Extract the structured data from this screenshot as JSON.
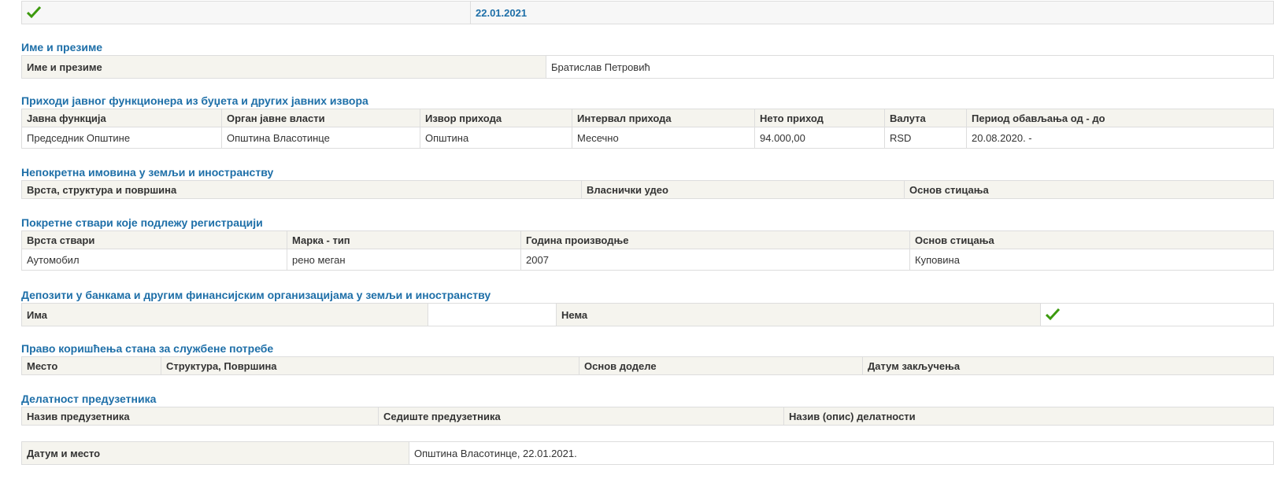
{
  "top": {
    "date": "22.01.2021"
  },
  "name_section": {
    "title": "Име и презиме",
    "label": "Име и презиме",
    "value": "Братислав Петровић"
  },
  "income": {
    "title": "Приходи јавног функционера из буџета и других јавних извора",
    "headers": [
      "Јавна функција",
      "Орган јавне власти",
      "Извор прихода",
      "Интервал прихода",
      "Нето приход",
      "Валута",
      "Период обављања од - до"
    ],
    "rows": [
      [
        "Председник Општине",
        "Општина Власотинце",
        "Општина",
        "Месечно",
        "94.000,00",
        "RSD",
        "20.08.2020. -"
      ]
    ]
  },
  "real_estate": {
    "title": "Непокретна имовина у земљи и иностранству",
    "headers": [
      "Врста, структура и површина",
      "Власнички удео",
      "Основ стицања"
    ]
  },
  "movables": {
    "title": "Покретне ствари које подлежу регистрацији",
    "headers": [
      "Врста ствари",
      "Марка - тип",
      "Година производње",
      "Основ стицања"
    ],
    "rows": [
      [
        "Аутомобил",
        "рено меган",
        "2007",
        "Куповина"
      ]
    ]
  },
  "deposits": {
    "title": "Депозити у банкама и другим финансијским организацијама у земљи и иностранству",
    "has_label": "Има",
    "none_label": "Нема"
  },
  "apartment": {
    "title": "Право коришћења стана за службене потребе",
    "headers": [
      "Место",
      "Структура, Површина",
      "Основ доделе",
      "Датум закључења"
    ]
  },
  "business": {
    "title": "Делатност предузетника",
    "headers": [
      "Назив предузетника",
      "Седиште предузетника",
      "Назив (опис) делатности"
    ]
  },
  "footer": {
    "label": "Датум и место",
    "value": "Општина Власотинце, 22.01.2021."
  },
  "icons": {
    "check_color": "#3c9a0e",
    "check": "check-icon"
  },
  "colors": {
    "section_title": "#1e6fa8",
    "header_bg": "#f5f4ee",
    "border": "#dddddd"
  }
}
